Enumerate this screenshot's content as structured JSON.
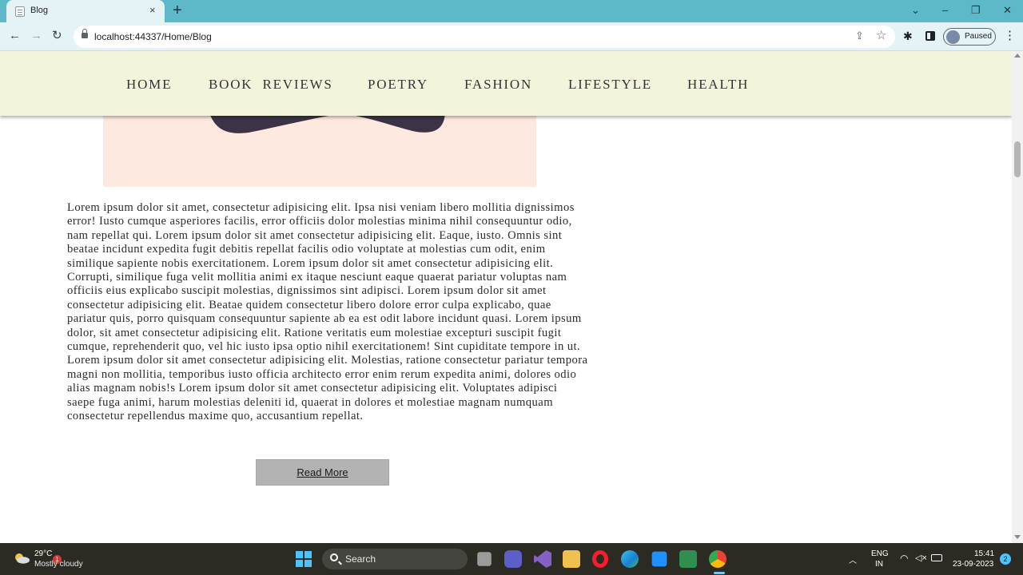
{
  "browser": {
    "tab_title": "Blog",
    "tab_close": "×",
    "new_tab": "+",
    "url": "localhost:44337/Home/Blog",
    "profile_status": "Paused",
    "window_controls": {
      "tabsearch": "⌄",
      "minimize": "–",
      "restore": "❐",
      "close": "✕"
    },
    "nav": {
      "back": "←",
      "forward": "→",
      "reload": "↻"
    },
    "icons": [
      "file-icon",
      "lock-icon",
      "share-icon",
      "star-icon",
      "extensions-icon",
      "side-panel-icon",
      "avatar",
      "menu-icon"
    ]
  },
  "site": {
    "nav_items": [
      "HOME",
      "BOOK  REVIEWS",
      "POETRY",
      "FASHION",
      "LIFESTYLE",
      "HEALTH"
    ],
    "article_text": "Lorem ipsum dolor sit amet, consectetur adipisicing elit. Ipsa nisi veniam libero mollitia dignissimos error! Iusto cumque asperiores facilis, error officiis dolor molestias minima nihil consequuntur odio, nam repellat qui. Lorem ipsum dolor sit amet consectetur adipisicing elit. Eaque, iusto. Omnis sint beatae incidunt expedita fugit debitis repellat facilis odio voluptate at molestias cum odit, enim similique sapiente nobis exercitationem. Lorem ipsum dolor sit amet consectetur adipisicing elit. Corrupti, similique fuga velit mollitia animi ex itaque nesciunt eaque quaerat pariatur voluptas nam officiis eius explicabo suscipit molestias, dignissimos sint adipisci. Lorem ipsum dolor sit amet consectetur adipisicing elit. Beatae quidem consectetur libero dolore error culpa explicabo, quae pariatur quis, porro quisquam consequuntur sapiente ab ea est odit labore incidunt quasi. Lorem ipsum dolor, sit amet consectetur adipisicing elit. Ratione veritatis eum molestiae excepturi suscipit fugit cumque, reprehenderit quo, vel hic iusto ipsa optio nihil exercitationem! Sint cupiditate tempore in ut. Lorem ipsum dolor sit amet consectetur adipisicing elit. Molestias, ratione consectetur pariatur tempora magni non mollitia, temporibus iusto officia architecto error enim rerum expedita animi, dolores odio alias magnam nobis!s Lorem ipsum dolor sit amet consectetur adipisicing elit. Voluptates adipisci saepe fuga animi, harum molestias deleniti id, quaerat in dolores et molestiae magnam numquam consectetur repellendus maxime quo, accusantium repellat.",
    "read_more": "Read More"
  },
  "taskbar": {
    "weather_temp": "29°C",
    "weather_desc": "Mostly cloudy",
    "weather_badge": "1",
    "search_label": "Search",
    "lang_top": "ENG",
    "lang_bottom": "IN",
    "time": "15:41",
    "date": "23-09-2023",
    "notification_count": "2",
    "tray_chevron": "︿",
    "tray_icons": [
      "wifi-icon",
      "mute-icon",
      "battery-icon"
    ]
  },
  "colors": {
    "tab_strip": "#5db8c9",
    "nav_bar": "#f4f4dd",
    "hero_background": "#fde9df",
    "hero_shape": "#3c3347",
    "button": "#b3b3b3",
    "taskbar": "#2b2b24"
  }
}
